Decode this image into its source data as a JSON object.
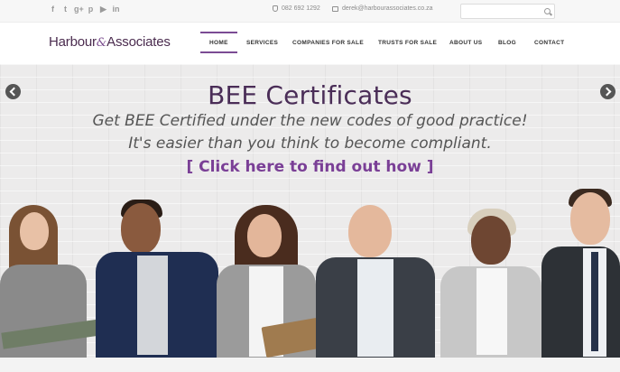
{
  "topbar": {
    "social_icons": [
      "facebook-icon",
      "twitter-icon",
      "google-plus-icon",
      "pinterest-icon",
      "youtube-icon",
      "linkedin-icon"
    ],
    "social_glyphs": [
      "f",
      "t",
      "g+",
      "p",
      "▶",
      "in"
    ],
    "phone": "082 692 1292",
    "email": "derek@harbourassociates.co.za",
    "search_placeholder": ""
  },
  "header": {
    "logo_left": "Harbour",
    "logo_amp": "&",
    "logo_right": "Associates",
    "nav": [
      "HOME",
      "SERVICES",
      "COMPANIES FOR SALE",
      "TRUSTS FOR SALE",
      "ABOUT US",
      "BLOG",
      "CONTACT"
    ],
    "active": "HOME"
  },
  "hero": {
    "title": "BEE Certificates",
    "subtitle_line1": "Get BEE Certified under the new codes of good practice!",
    "subtitle_line2": "It's easier than you think to become compliant.",
    "cta": "[ Click here to find out how ]"
  },
  "colors": {
    "brand_purple": "#4a2d57",
    "accent_purple": "#7a3f96",
    "nav_underline": "#7b4b94"
  }
}
